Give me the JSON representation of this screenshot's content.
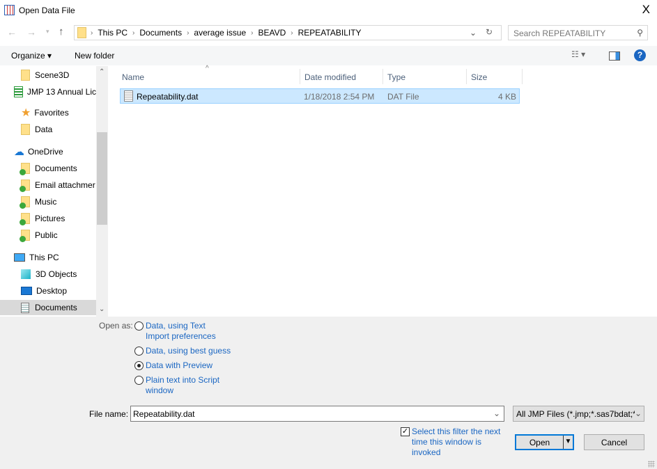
{
  "window": {
    "title": "Open Data File",
    "close": "X"
  },
  "address": {
    "crumbs": [
      "This PC",
      "Documents",
      "average issue",
      "BEAVD",
      "REPEATABILITY"
    ],
    "search_placeholder": "Search REPEATABILITY"
  },
  "toolbar": {
    "organize": "Organize ▾",
    "new_folder": "New folder"
  },
  "nav": {
    "items": [
      {
        "label": "Scene3D",
        "type": "folder"
      },
      {
        "label": "JMP 13 Annual Lic",
        "type": "jmp"
      },
      {
        "label": "Favorites",
        "type": "star"
      },
      {
        "label": "Data",
        "type": "folder"
      },
      {
        "label": "OneDrive",
        "type": "cloud"
      },
      {
        "label": "Documents",
        "type": "sync"
      },
      {
        "label": "Email attachmer",
        "type": "sync"
      },
      {
        "label": "Music",
        "type": "sync"
      },
      {
        "label": "Pictures",
        "type": "sync"
      },
      {
        "label": "Public",
        "type": "sync"
      },
      {
        "label": "This PC",
        "type": "pc"
      },
      {
        "label": "3D Objects",
        "type": "cube"
      },
      {
        "label": "Desktop",
        "type": "desktop"
      },
      {
        "label": "Documents",
        "type": "doc"
      }
    ]
  },
  "list": {
    "columns": [
      "Name",
      "Date modified",
      "Type",
      "Size"
    ],
    "files": [
      {
        "name": "Repeatability.dat",
        "date": "1/18/2018 2:54 PM",
        "type": "DAT File",
        "size": "4 KB"
      }
    ]
  },
  "open_as": {
    "label": "Open as:",
    "options": [
      {
        "line1": "Data, using Text",
        "line2": "Import preferences",
        "selected": false
      },
      {
        "line1": "Data, using best guess",
        "line2": "",
        "selected": false
      },
      {
        "line1": "Data with Preview",
        "line2": "",
        "selected": true
      },
      {
        "line1": "Plain text into Script",
        "line2": "window",
        "selected": false
      }
    ]
  },
  "file_name": {
    "label": "File name:",
    "value": "Repeatability.dat"
  },
  "filter": {
    "value": "All JMP Files (*.jmp;*.sas7bdat;*"
  },
  "remember": {
    "line1": "Select this filter the next",
    "line2": "time this window is",
    "line3": "invoked",
    "checked": true
  },
  "buttons": {
    "open": "Open",
    "cancel": "Cancel"
  }
}
